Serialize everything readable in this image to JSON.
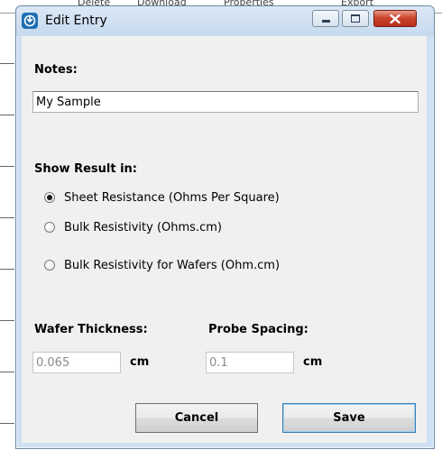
{
  "background_app": {
    "tabs": [
      "Delete",
      "Download",
      "Properties",
      "Export"
    ]
  },
  "window": {
    "title": "Edit Entry",
    "app_icon": "app-icon",
    "controls": [
      "minimize-icon",
      "maximize-icon",
      "close-icon"
    ]
  },
  "notes": {
    "label": "Notes:",
    "value": "My Sample"
  },
  "result": {
    "label": "Show Result in:",
    "options": [
      {
        "label": "Sheet Resistance (Ohms Per Square)",
        "checked": true
      },
      {
        "label": "Bulk Resistivity (Ohms.cm)",
        "checked": false
      },
      {
        "label": "Bulk Resistivity for Wafers (Ohm.cm)",
        "checked": false
      }
    ]
  },
  "wafer_thickness": {
    "label": "Wafer Thickness:",
    "value": "0.065",
    "unit": "cm"
  },
  "probe_spacing": {
    "label": "Probe Spacing:",
    "value": "0.1",
    "unit": "cm"
  },
  "buttons": {
    "cancel": "Cancel",
    "save": "Save"
  },
  "colors": {
    "title_bar": "#c6d9ee",
    "close_button": "#c9432c",
    "client_bg": "#f0f0f0"
  }
}
